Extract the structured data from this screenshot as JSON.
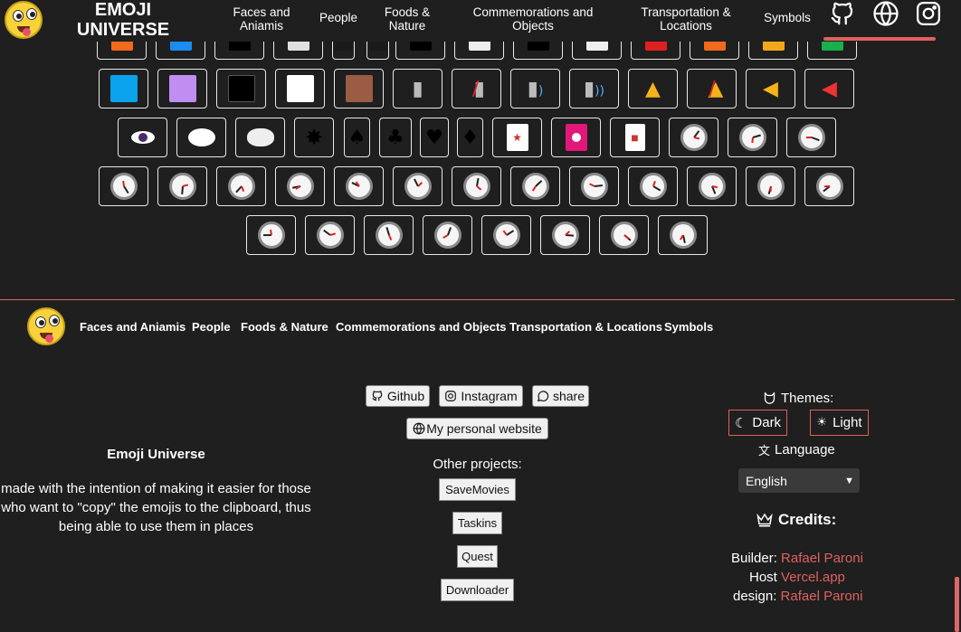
{
  "header": {
    "brand_line1": "EMOJI",
    "brand_line2": "UNIVERSE",
    "nav": [
      {
        "line1": "Faces and",
        "line2": "Aniamis"
      },
      {
        "line1": "People",
        "line2": ""
      },
      {
        "line1": "Foods &",
        "line2": "Nature"
      },
      {
        "line1": "Commemorations and",
        "line2": "Objects"
      },
      {
        "line1": "Transportation &",
        "line2": "Locations"
      },
      {
        "line1": "Symbols",
        "line2": ""
      }
    ],
    "icons": [
      "github-icon",
      "globe-icon",
      "instagram-icon"
    ]
  },
  "grid": {
    "row1_colors": [
      "#f26a1b",
      "#1b8cf2",
      "#000000",
      "#e0e0e0",
      "#1a1a1a",
      "#1a1a1a",
      "#000000",
      "#eeeeee",
      "#000000",
      "#eeeeee",
      "#e02020",
      "#f26a1b",
      "#f2a81b",
      "#18b04a"
    ],
    "row2": [
      "blue-square",
      "purple-square",
      "black-square",
      "white-square",
      "brown-square",
      "speaker-muted",
      "speaker-off",
      "speaker-low",
      "speaker-high",
      "bell",
      "bell-slash",
      "loudspeaker",
      "megaphone"
    ],
    "row3": [
      "eye-in-bubble",
      "speech-bubble",
      "thought-bubble",
      "anger-bubble",
      "spade",
      "club",
      "heart-suit",
      "diamond-suit",
      "joker",
      "flower-card",
      "mahjong",
      "clock",
      "clock",
      "clock"
    ],
    "row4_clock_count": 13,
    "row5_clock_count": 8,
    "colors": {
      "purple": "#c08ef0",
      "brown": "#9a5c45",
      "blue": "#0aa2ec",
      "bell": "#f7b21a"
    }
  },
  "footer": {
    "nav": [
      "Faces and Aniamis",
      "People",
      "Foods & Nature",
      "Commemorations and Objects",
      "Transportation & Locations",
      "Symbols"
    ],
    "title": "Emoji Universe",
    "description": "made with the intention of making it easier for those who want to \"copy\" the emojis to the clipboard, thus being able to use them in places",
    "links": {
      "github": "Github",
      "instagram": "Instagram",
      "share": "share",
      "website": "My personal website"
    },
    "other_projects_label": "Other projects:",
    "projects": [
      "SaveMovies",
      "Taskins",
      "Quest",
      "Downloader"
    ],
    "themes_label": "Themes:",
    "theme_dark": "Dark",
    "theme_light": "Light",
    "language_label": "Language",
    "language_value": "English",
    "credits_title": "Credits:",
    "credits": [
      {
        "key": "Builder:",
        "value": "Rafael Paroni"
      },
      {
        "key": "Host",
        "value": "Vercel.app"
      },
      {
        "key": "design:",
        "value": "Rafael Paroni"
      }
    ],
    "accent": "#e06060"
  }
}
